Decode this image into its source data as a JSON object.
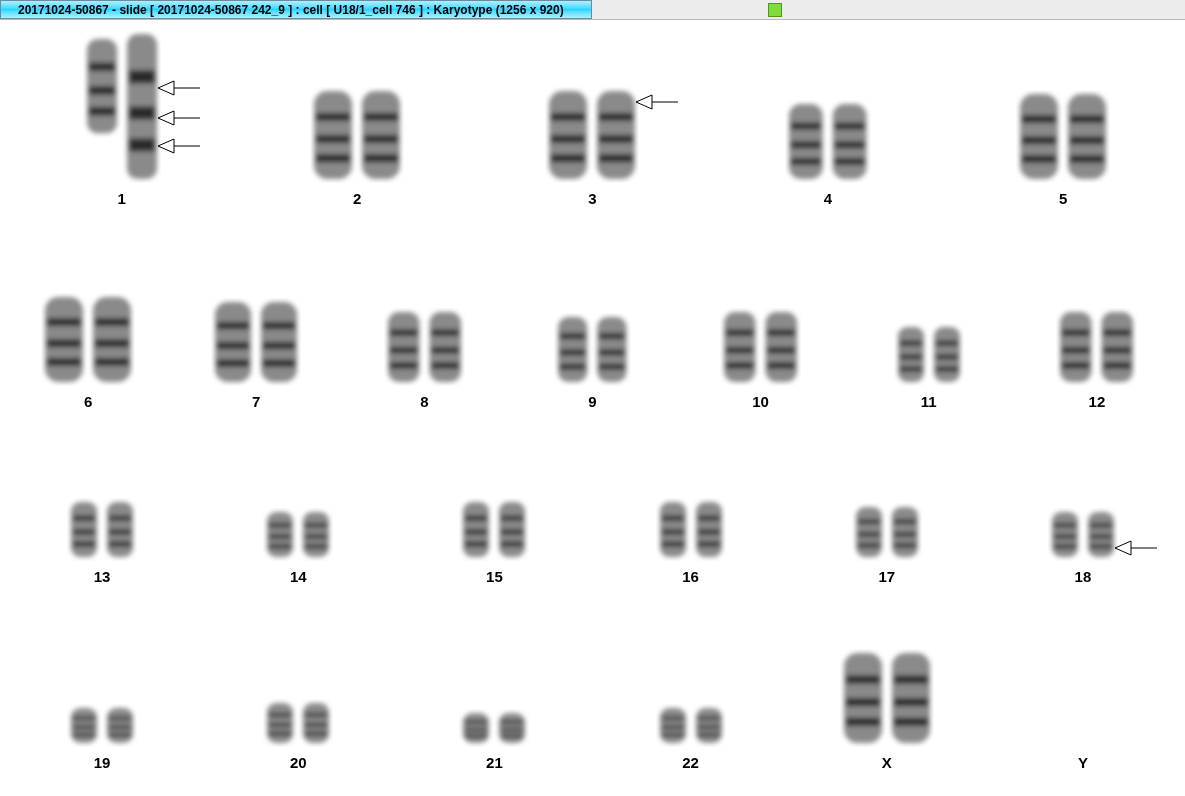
{
  "window": {
    "title": "20171024-50867 - slide [ 20171024-50867 242_9 ] : cell [ U18/1_cell 746 ] : Karyotype  (1256 x 920)"
  },
  "rows": [
    {
      "items": [
        {
          "label": "1",
          "kind": "pair",
          "arrows": [
            {
              "kind": "open"
            },
            {
              "kind": "open"
            },
            {
              "kind": "open"
            }
          ]
        },
        {
          "label": "2",
          "kind": "pair"
        },
        {
          "label": "3",
          "kind": "pair",
          "arrows": [
            {
              "kind": "open"
            }
          ]
        },
        {
          "label": "4",
          "kind": "pair"
        },
        {
          "label": "5",
          "kind": "pair"
        }
      ]
    },
    {
      "items": [
        {
          "label": "6",
          "kind": "pair"
        },
        {
          "label": "7",
          "kind": "pair"
        },
        {
          "label": "8",
          "kind": "pair"
        },
        {
          "label": "9",
          "kind": "pair"
        },
        {
          "label": "10",
          "kind": "pair"
        },
        {
          "label": "11",
          "kind": "pair"
        },
        {
          "label": "12",
          "kind": "pair"
        }
      ]
    },
    {
      "items": [
        {
          "label": "13",
          "kind": "pair"
        },
        {
          "label": "14",
          "kind": "pair"
        },
        {
          "label": "15",
          "kind": "pair"
        },
        {
          "label": "16",
          "kind": "pair"
        },
        {
          "label": "17",
          "kind": "pair"
        },
        {
          "label": "18",
          "kind": "pair",
          "arrows": [
            {
              "kind": "open"
            }
          ]
        }
      ]
    },
    {
      "items": [
        {
          "label": "19",
          "kind": "pair"
        },
        {
          "label": "20",
          "kind": "pair"
        },
        {
          "label": "21",
          "kind": "pair"
        },
        {
          "label": "22",
          "kind": "pair"
        },
        {
          "label": "X",
          "kind": "pair"
        },
        {
          "label": "Y",
          "kind": "empty"
        }
      ]
    }
  ]
}
